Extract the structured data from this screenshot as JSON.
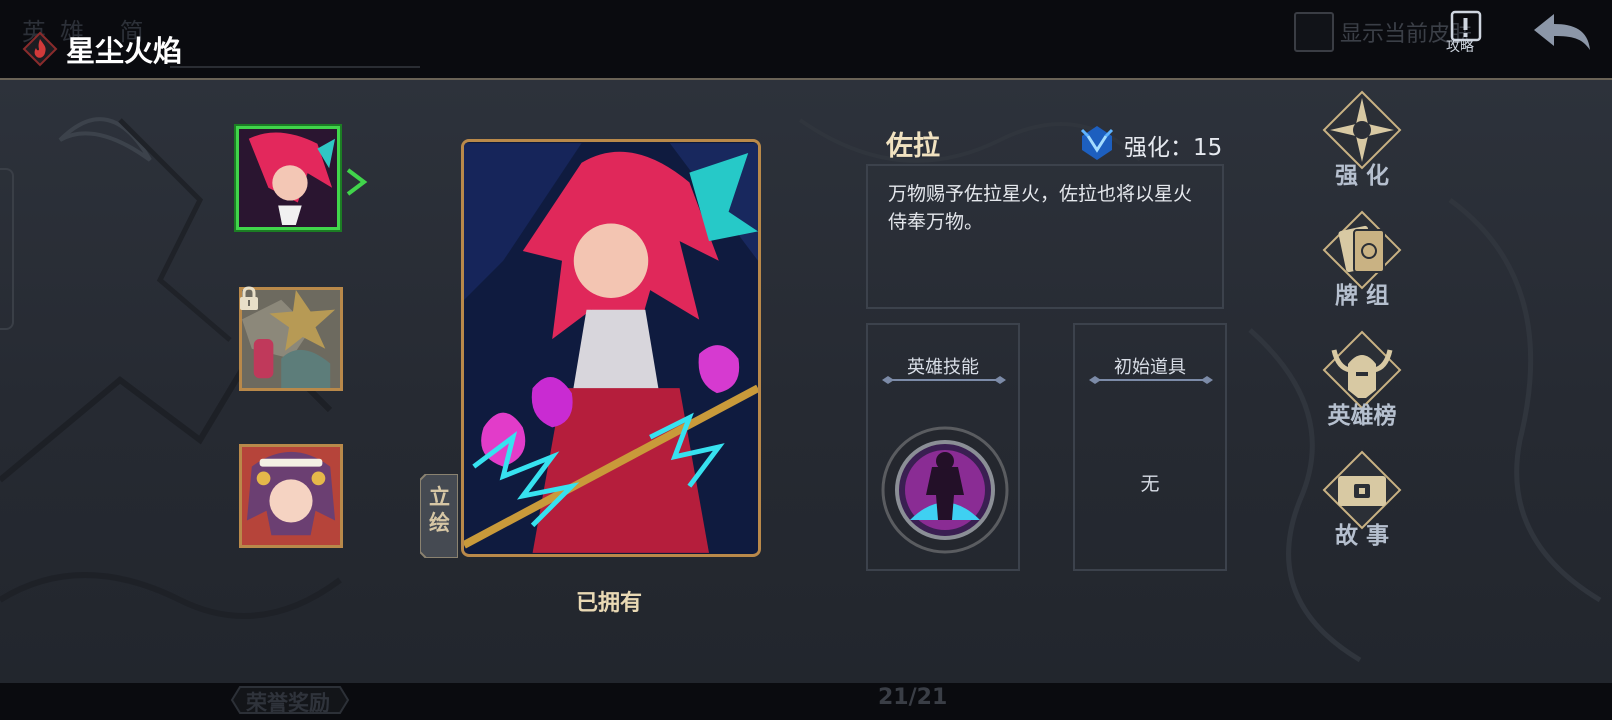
{
  "top_bar": {
    "bg_tabs": "英雄 简",
    "title": "星尘火焰",
    "show_skin_label": "显示当前皮肤",
    "guide_label": "攻略"
  },
  "hero_list": [
    {
      "name": "佐拉",
      "selected": true,
      "locked": false
    },
    {
      "name": "locked-hero",
      "selected": false,
      "locked": true
    },
    {
      "name": "purple-hair-hero",
      "selected": false,
      "locked": false
    }
  ],
  "card": {
    "art_tab_label": "立绘",
    "owned_label": "已拥有"
  },
  "hero_info": {
    "name": "佐拉",
    "enhance_label": "强化：15",
    "description": "万物赐予佐拉星火，佐拉也将以星火侍奉万物。",
    "skill_title": "英雄技能",
    "item_title": "初始道具",
    "item_value": "无"
  },
  "side_menu": [
    {
      "label": "强 化",
      "icon": "compass-star-icon"
    },
    {
      "label": "牌 组",
      "icon": "card-deck-icon"
    },
    {
      "label": "英雄榜",
      "icon": "horned-helmet-icon"
    },
    {
      "label": "故 事",
      "icon": "story-book-icon"
    }
  ],
  "bottom_bar": {
    "honor_label": "荣誉奖励",
    "page_indicator": "21/21"
  },
  "colors": {
    "gold_border": "#b9894a",
    "selected_green": "#41d44b",
    "panel_bg": "#2a2f37",
    "name_gold": "#f1e2c0"
  }
}
